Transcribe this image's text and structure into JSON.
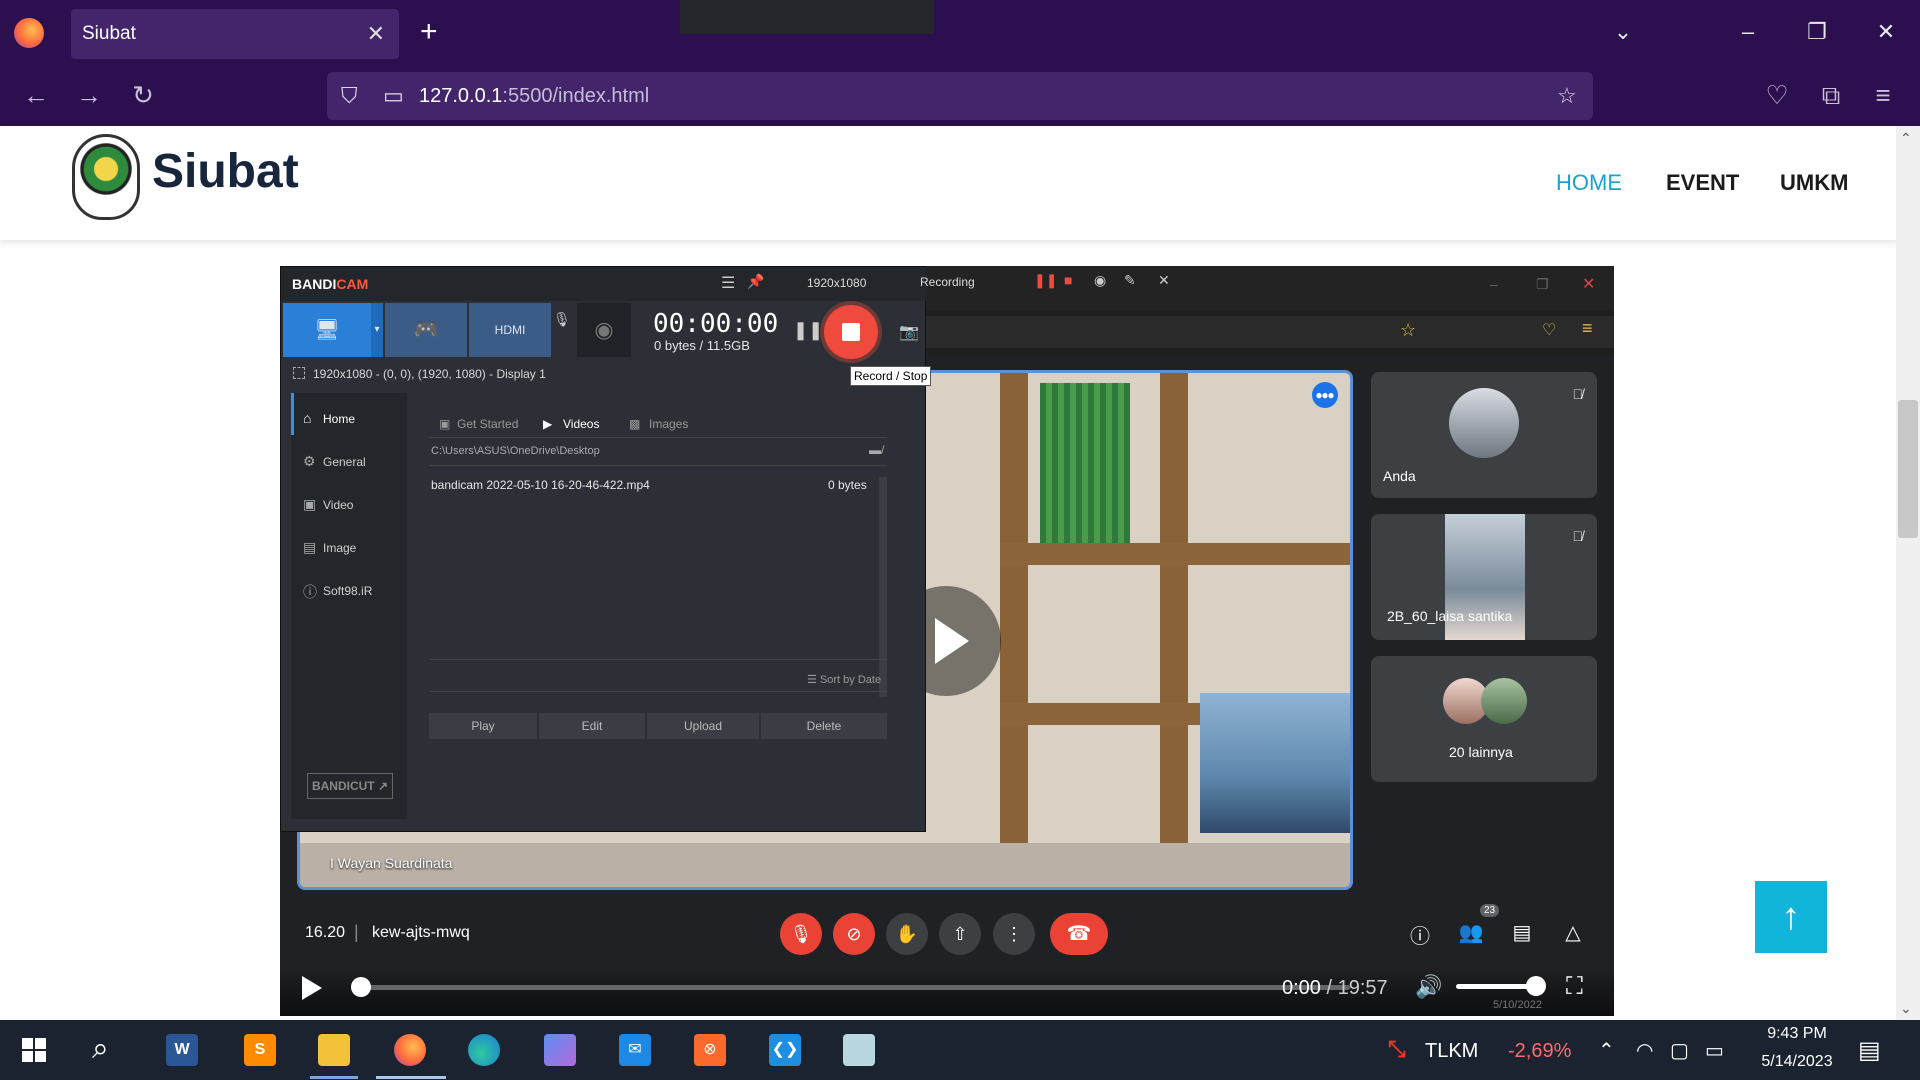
{
  "browser": {
    "tab_title": "Siubat",
    "tab_close": "✕",
    "new_tab": "+",
    "url_host": "127.0.0.1",
    "url_path": ":5500/index.html",
    "icons": [
      "firefox-logo",
      "back-icon",
      "forward-icon",
      "reload-icon",
      "shield-icon",
      "page-icon",
      "star-icon",
      "pocket-icon",
      "extensions-icon",
      "menu-icon"
    ]
  },
  "site": {
    "brand": "Siubat",
    "nav": {
      "home": "HOME",
      "event": "EVENT",
      "umkm": "UMKM"
    },
    "accent_color": "#19a3cf",
    "back_to_top": "↑"
  },
  "meet": {
    "main_speaker": "I Wayan Suardinata",
    "participants": [
      {
        "name": "Anda"
      },
      {
        "name": "2B_60_laisa santika"
      },
      {
        "name": "20 lainnya"
      }
    ],
    "meeting_time": "16.20",
    "separator": "|",
    "meeting_code": "kew-ajts-mwq",
    "people_count": "23"
  },
  "player": {
    "time_current": "0:00",
    "time_total": " / 19:57",
    "ghost_date": "5/10/2022"
  },
  "bandicam": {
    "logo_a": "BANDI",
    "logo_b": "CAM",
    "resolution": "1920x1080",
    "recording_label": "Recording",
    "timer": "00:00:00",
    "bytes": "0 bytes / 11.5GB",
    "tooltip": "Record / Stop",
    "region": "1920x1080 - (0, 0), (1920, 1080) - Display 1",
    "sidebar": [
      "Home",
      "General",
      "Video",
      "Image",
      "Soft98.iR"
    ],
    "tabs": {
      "get_started": "Get Started",
      "videos": "Videos",
      "images": "Images"
    },
    "path": "C:\\Users\\ASUS\\OneDrive\\Desktop",
    "file_name": "bandicam 2022-05-10 16-20-46-422.mp4",
    "file_size": "0 bytes",
    "sort": "☰ Sort by Date",
    "actions": [
      "Play",
      "Edit",
      "Upload",
      "Delete"
    ],
    "bandicut": "BANDICUT ↗"
  },
  "taskbar": {
    "stock_name": "TLKM",
    "stock_change": "-2,69%",
    "time": "9:43 PM",
    "date": "5/14/2023"
  }
}
